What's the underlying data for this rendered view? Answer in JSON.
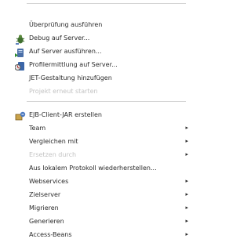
{
  "context_menu": {
    "items": [
      {
        "label": "Überprüfung ausführen",
        "icon": null,
        "enabled": true,
        "submenu": false
      },
      {
        "label": "Debug auf Server...",
        "icon": "debug-bug-icon",
        "enabled": true,
        "submenu": false
      },
      {
        "label": "Auf Server ausführen...",
        "icon": "run-on-server-icon",
        "enabled": true,
        "submenu": false
      },
      {
        "label": "Profilermittlung auf Server...",
        "icon": "profile-icon",
        "enabled": true,
        "submenu": false
      },
      {
        "label": "JET-Gestaltung hinzufügen",
        "icon": null,
        "enabled": true,
        "submenu": false
      },
      {
        "label": "Projekt erneut starten",
        "icon": null,
        "enabled": false,
        "submenu": false
      },
      {
        "label": "EJB-Client-JAR erstellen",
        "icon": "ejb-client-jar-icon",
        "enabled": true,
        "submenu": false
      },
      {
        "label": "Team",
        "icon": null,
        "enabled": true,
        "submenu": true
      },
      {
        "label": "Vergleichen mit",
        "icon": null,
        "enabled": true,
        "submenu": true
      },
      {
        "label": "Ersetzen durch",
        "icon": null,
        "enabled": false,
        "submenu": true
      },
      {
        "label": "Aus lokalem Protokoll wiederherstellen...",
        "icon": null,
        "enabled": true,
        "submenu": false
      },
      {
        "label": "Webservices",
        "icon": null,
        "enabled": true,
        "submenu": true
      },
      {
        "label": "Zielserver",
        "icon": null,
        "enabled": true,
        "submenu": true
      },
      {
        "label": "Migrieren",
        "icon": null,
        "enabled": true,
        "submenu": true
      },
      {
        "label": "Generieren",
        "icon": null,
        "enabled": true,
        "submenu": true
      },
      {
        "label": "Access-Beans",
        "icon": null,
        "enabled": true,
        "submenu": true
      }
    ],
    "submenu_arrow": "▸"
  }
}
